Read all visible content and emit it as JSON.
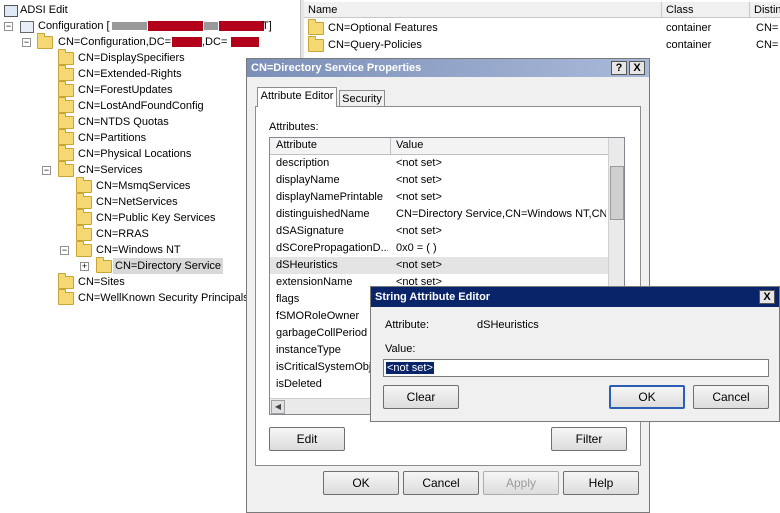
{
  "tree": {
    "root": "ADSI Edit",
    "config": "Configuration [",
    "config_tail": "T]",
    "cn_config": "CN=Configuration,DC=",
    "cn_config_mid": ",DC=",
    "items": [
      "CN=DisplaySpecifiers",
      "CN=Extended-Rights",
      "CN=ForestUpdates",
      "CN=LostAndFoundConfig",
      "CN=NTDS Quotas",
      "CN=Partitions",
      "CN=Physical Locations",
      "CN=Services",
      "CN=MsmqServices",
      "CN=NetServices",
      "CN=Public Key Services",
      "CN=RRAS",
      "CN=Windows NT",
      "CN=Directory Service",
      "CN=Sites",
      "CN=WellKnown Security Principals"
    ]
  },
  "list": {
    "headers": [
      "Name",
      "Class",
      "Distin"
    ],
    "rows": [
      {
        "name": "CN=Optional Features",
        "class": "container",
        "dn": "CN="
      },
      {
        "name": "CN=Query-Policies",
        "class": "container",
        "dn": "CN="
      }
    ]
  },
  "props": {
    "title": "CN=Directory Service Properties",
    "help_btn": "?",
    "close_btn": "X",
    "tabs": [
      "Attribute Editor",
      "Security"
    ],
    "attributes_label": "Attributes:",
    "col_attr": "Attribute",
    "col_value": "Value",
    "rows": [
      {
        "attr": "description",
        "value": "<not set>"
      },
      {
        "attr": "displayName",
        "value": "<not set>"
      },
      {
        "attr": "displayNamePrintable",
        "value": "<not set>"
      },
      {
        "attr": "distinguishedName",
        "value": "CN=Directory Service,CN=Windows NT,CN="
      },
      {
        "attr": "dSASignature",
        "value": "<not set>"
      },
      {
        "attr": "dSCorePropagationD...",
        "value": "0x0 = (  )"
      },
      {
        "attr": "dSHeuristics",
        "value": "<not set>"
      },
      {
        "attr": "extensionName",
        "value": "<not set>"
      },
      {
        "attr": "flags",
        "value": ""
      },
      {
        "attr": "fSMORoleOwner",
        "value": ""
      },
      {
        "attr": "garbageCollPeriod",
        "value": ""
      },
      {
        "attr": "instanceType",
        "value": ""
      },
      {
        "attr": "isCriticalSystemObje",
        "value": ""
      },
      {
        "attr": "isDeleted",
        "value": ""
      }
    ],
    "edit_btn": "Edit",
    "filter_btn": "Filter",
    "ok_btn": "OK",
    "cancel_btn": "Cancel",
    "apply_btn": "Apply",
    "helpbtn": "Help"
  },
  "sae": {
    "title": "String Attribute Editor",
    "close_btn": "X",
    "attribute_label": "Attribute:",
    "attribute_value": "dSHeuristics",
    "value_label": "Value:",
    "value": "<not set>",
    "clear_btn": "Clear",
    "ok_btn": "OK",
    "cancel_btn": "Cancel"
  },
  "colors": {
    "title_active": "#0a246a",
    "title_inactive": "#7a96df",
    "selection": "#0a246a",
    "redaction": "#b3001b"
  }
}
